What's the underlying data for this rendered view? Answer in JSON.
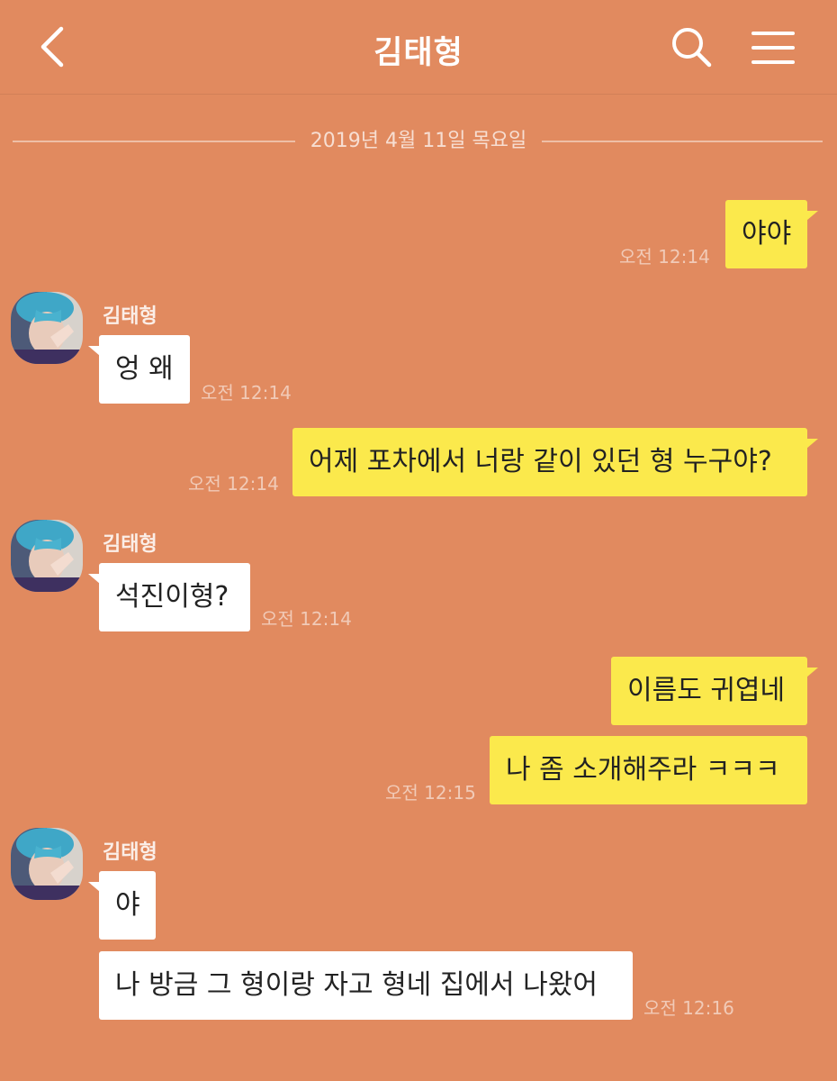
{
  "header": {
    "title": "김태형",
    "back_icon": "chevron-left-icon",
    "search_icon": "search-icon",
    "menu_icon": "menu-icon"
  },
  "date_divider": "2019년 4월 11일 목요일",
  "colors": {
    "background": "#e18a5f",
    "my_bubble": "#fbe94c",
    "their_bubble": "#ffffff"
  },
  "messages": [
    {
      "from": "me",
      "text": "야야",
      "time": "오전 12:14"
    },
    {
      "from": "them",
      "sender": "김태형",
      "text": "엉 왜",
      "time": "오전 12:14"
    },
    {
      "from": "me",
      "text": "어제 포차에서 너랑 같이 있던 형 누구야?",
      "time": "오전 12:14"
    },
    {
      "from": "them",
      "sender": "김태형",
      "text": "석진이형?",
      "time": "오전 12:14"
    },
    {
      "from": "me",
      "text": "이름도 귀엽네",
      "time": ""
    },
    {
      "from": "me",
      "text": "나 좀 소개해주라 ㅋㅋㅋ",
      "time": "오전 12:15"
    },
    {
      "from": "them",
      "sender": "김태형",
      "text": "야",
      "time": ""
    },
    {
      "from": "them",
      "text": "나 방금 그 형이랑 자고 형네 집에서 나왔어",
      "time": "오전 12:16"
    }
  ]
}
